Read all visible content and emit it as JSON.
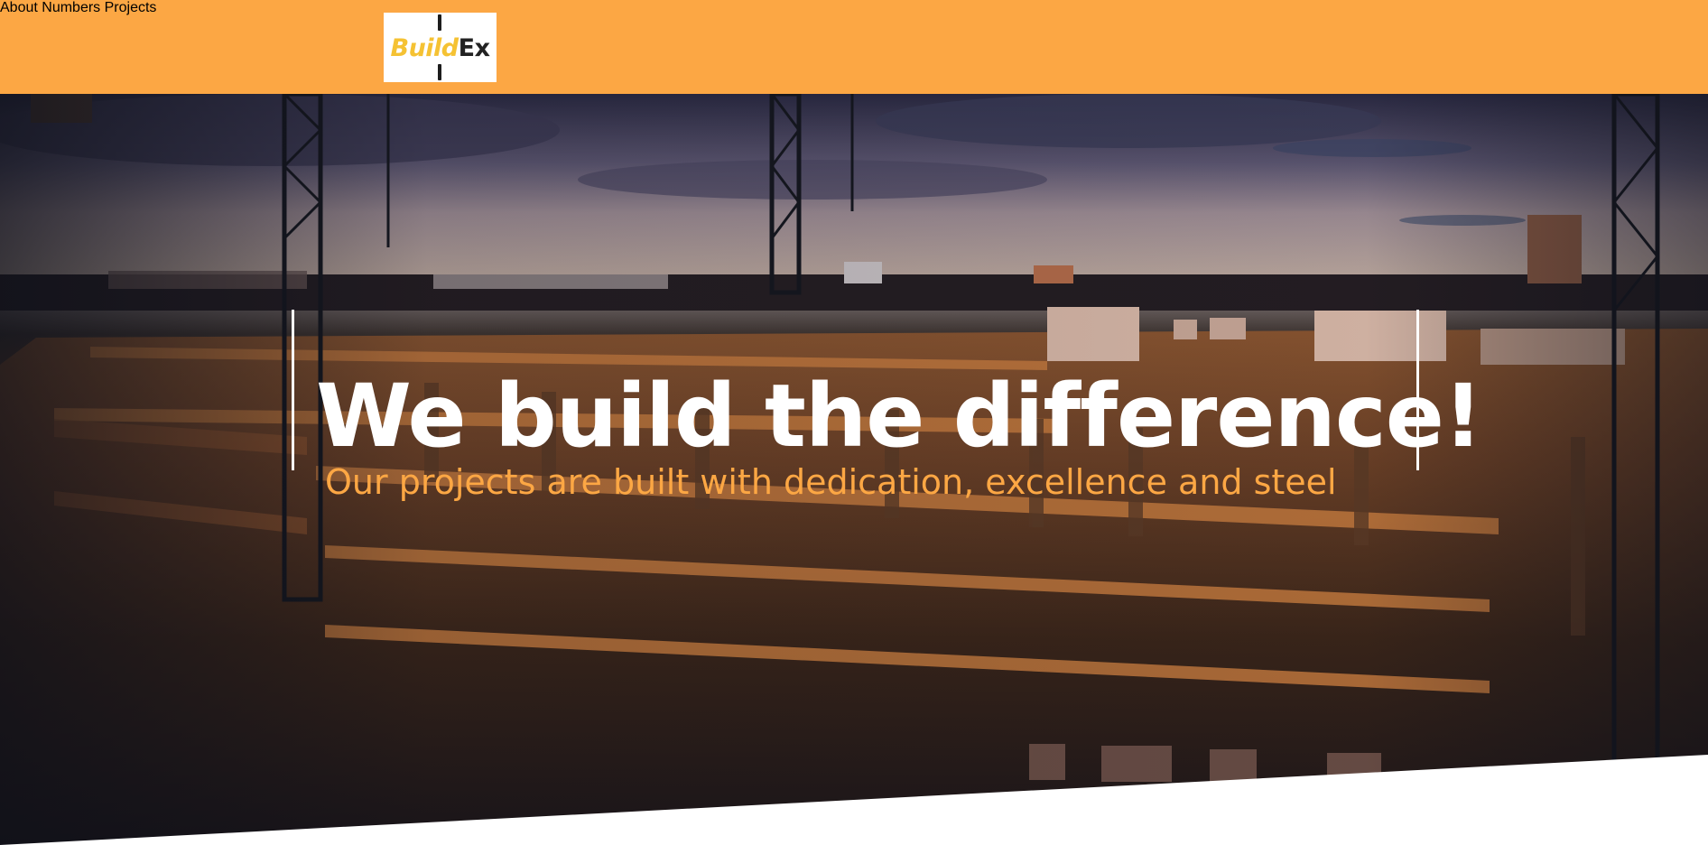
{
  "header": {
    "logo": {
      "part1": "Build",
      "part2": "Ex"
    },
    "nav": [
      {
        "label": "About"
      },
      {
        "label": "Numbers"
      },
      {
        "label": "Projects"
      }
    ]
  },
  "hero": {
    "headline": "We build the difference!",
    "subheadline": "Our projects are built with dedication, excellence and steel"
  },
  "colors": {
    "header_background": "#fca744",
    "accent": "#fca744",
    "nav_text": "#4b4b55",
    "headline_text": "#ffffff"
  }
}
